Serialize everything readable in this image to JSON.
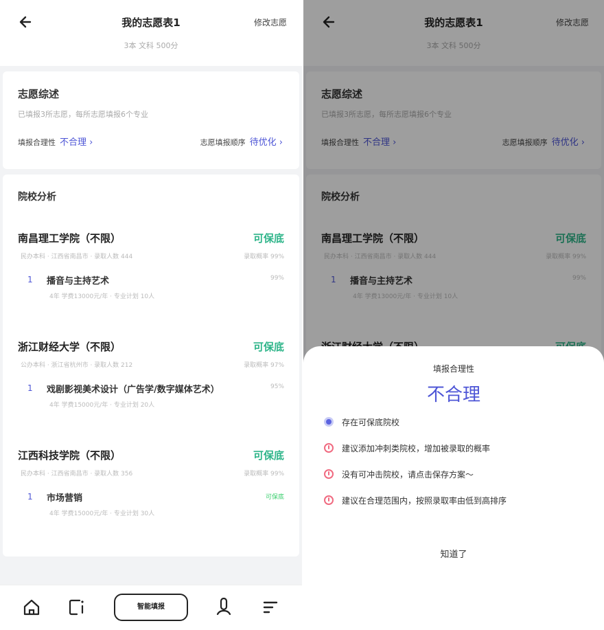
{
  "header": {
    "title": "我的志愿表1",
    "subtitle": "3本 文科 500分",
    "edit_label": "修改志愿"
  },
  "overview": {
    "title": "志愿综述",
    "description": "已填报3所志愿，每所志愿填报6个专业",
    "rationality_label": "填报合理性",
    "rationality_value": "不合理 ›",
    "order_label": "志愿填报顺序",
    "order_value": "待优化 ›"
  },
  "analysis": {
    "title": "院校分析",
    "schools": [
      {
        "name": "南昌理工学院（不限）",
        "tag": "可保底",
        "meta": "民办本科 · 江西省南昌市 · 录取人数 444",
        "meta_right": "录取概率 99%",
        "major_no": "1",
        "major_name": "播音与主持艺术",
        "major_right": "99%",
        "major_meta": "4年 学费13000元/年 · 专业计划 10人",
        "major_right_green": false
      },
      {
        "name": "浙江财经大学（不限）",
        "tag": "可保底",
        "meta": "公办本科 · 浙江省杭州市 · 录取人数 212",
        "meta_right": "录取概率 97%",
        "major_no": "1",
        "major_name": "戏剧影视美术设计（广告学/数字媒体艺术）",
        "major_right": "95%",
        "major_meta": "4年 学费15000元/年 · 专业计划 20人",
        "major_right_green": false
      },
      {
        "name": "江西科技学院（不限）",
        "tag": "可保底",
        "meta": "民办本科 · 江西省南昌市 · 录取人数 356",
        "meta_right": "录取概率 99%",
        "major_no": "1",
        "major_name": "市场营销",
        "major_right": "可保底",
        "major_meta": "4年 学费15000元/年 · 专业计划 30人",
        "major_right_green": true
      }
    ]
  },
  "tabbar": {
    "center_label": "智能填报",
    "icons": [
      "home-icon",
      "list-icon",
      "user-icon",
      "menu-icon"
    ]
  },
  "sheet": {
    "label": "填报合理性",
    "value": "不合理",
    "items": [
      {
        "text": "存在可保底院校",
        "status": "ok"
      },
      {
        "text": "建议添加冲刺类院校，增加被录取的概率",
        "status": "warn"
      },
      {
        "text": "没有可冲击院校，请点击保存方案～",
        "status": "warn"
      },
      {
        "text": "建议在合理范围内，按照录取率由低到高排序",
        "status": "warn"
      }
    ],
    "button": "知道了"
  },
  "colors": {
    "accent": "#4d55d6",
    "safe": "#2fb58a",
    "warn": "#f06a80"
  }
}
